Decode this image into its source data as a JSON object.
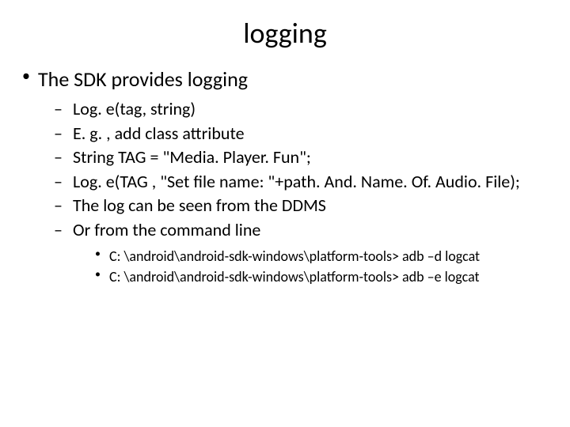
{
  "title": "logging",
  "bullets_level1": [
    "The SDK provides logging"
  ],
  "bullets_level2": [
    "Log. e(tag, string)",
    "E. g. , add class attribute",
    "String TAG = \"Media. Player. Fun\";",
    " Log. e(TAG , \"Set file name: \"+path. And. Name. Of. Audio. File);",
    "The log can be seen from the DDMS",
    "Or from the command line"
  ],
  "bullets_level3": [
    "C: \\android\\android-sdk-windows\\platform-tools> adb –d logcat",
    "C: \\android\\android-sdk-windows\\platform-tools> adb –e logcat"
  ]
}
